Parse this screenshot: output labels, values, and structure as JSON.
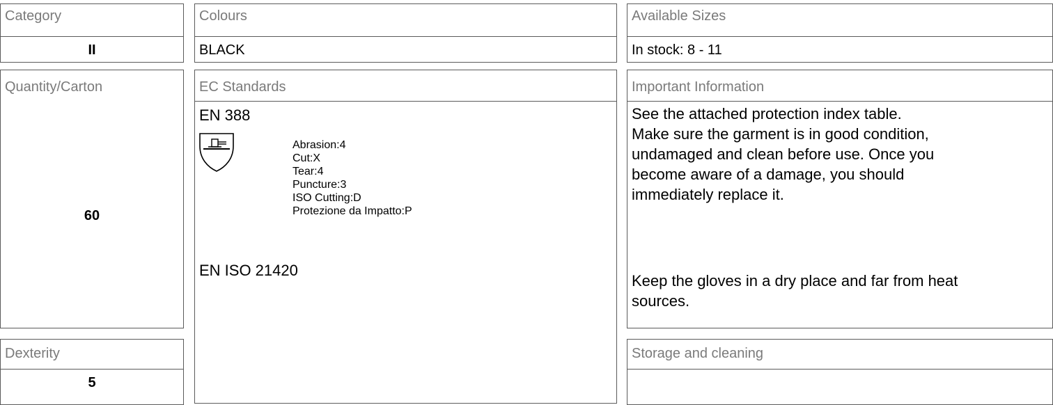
{
  "category": {
    "label": "Category",
    "value": "II"
  },
  "colours": {
    "label": "Colours",
    "value": "BLACK"
  },
  "sizes": {
    "label": "Available Sizes",
    "value": "In stock: 8 - 11"
  },
  "quantity": {
    "label": "Quantity/Carton",
    "value": "60"
  },
  "ec": {
    "label": "EC Standards",
    "standards": [
      {
        "name": "EN 388",
        "icon": "hammer-shield-icon",
        "ratings": [
          "Abrasion:4",
          "Cut:X",
          "Tear:4",
          "Puncture:3",
          "ISO Cutting:D",
          "Protezione da Impatto:P"
        ]
      },
      {
        "name": "EN ISO 21420"
      }
    ]
  },
  "important": {
    "label": "Important Information",
    "lines": [
      "See the attached protection index table.",
      "Make sure the garment is in good condition,",
      "undamaged and clean before use. Once you",
      "become aware of a damage, you should",
      "immediately replace it."
    ],
    "storage_lines": [
      "Keep the gloves in a dry place and far from heat",
      "sources."
    ]
  },
  "dexterity": {
    "label": "Dexterity",
    "value": "5"
  },
  "storage": {
    "label": "Storage and cleaning"
  }
}
